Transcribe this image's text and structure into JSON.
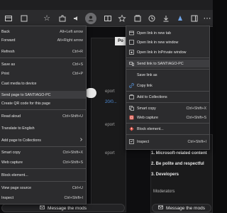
{
  "colors": {
    "menu_bg": "#2c2c2e",
    "menu_highlight": "#3d3d40",
    "page_bg": "#0e0e10",
    "web_capture_icon": "#e2564b",
    "block_element_icon": "#e2564b",
    "link_icon": "#5a9be8"
  },
  "left_menu": {
    "items": [
      {
        "label": "Back",
        "shortcut": "Alt+Left arrow"
      },
      {
        "label": "Forward",
        "shortcut": "Alt+Right arrow"
      },
      {
        "label": "Refresh",
        "shortcut": "Ctrl+R"
      },
      {
        "label": "Save as",
        "shortcut": "Ctrl+S"
      },
      {
        "label": "Print",
        "shortcut": "Ctrl+P"
      },
      {
        "label": "Cast media to device",
        "shortcut": ""
      },
      {
        "label": "Send page to SANTIAGO-PC",
        "shortcut": ""
      },
      {
        "label": "Create QR code for this page",
        "shortcut": ""
      },
      {
        "label": "Read aloud",
        "shortcut": "Ctrl+Shift+U"
      },
      {
        "label": "Translate to English",
        "shortcut": ""
      },
      {
        "label": "Add page to Collections",
        "shortcut": ""
      },
      {
        "label": "Smart copy",
        "shortcut": "Ctrl+Shift+X"
      },
      {
        "label": "Web capture",
        "shortcut": "Ctrl+Shift+S"
      },
      {
        "label": "Block element...",
        "shortcut": ""
      },
      {
        "label": "View page source",
        "shortcut": "Ctrl+U"
      },
      {
        "label": "Inspect",
        "shortcut": "Ctrl+Shift+I"
      }
    ]
  },
  "right_menu": {
    "items": [
      {
        "label": "Open link in new tab",
        "shortcut": "",
        "icon": "new-tab-icon"
      },
      {
        "label": "Open link in new window",
        "shortcut": "",
        "icon": "new-window-icon"
      },
      {
        "label": "Open link in InPrivate window",
        "shortcut": "",
        "icon": "inprivate-icon"
      },
      {
        "label": "Send link to SANTIAGO-PC",
        "shortcut": "",
        "icon": "send-icon"
      },
      {
        "label": "Save link as",
        "shortcut": "",
        "icon": ""
      },
      {
        "label": "Copy link",
        "shortcut": "",
        "icon": "link-icon"
      },
      {
        "label": "Add to Collections",
        "shortcut": "",
        "icon": "collections-icon"
      },
      {
        "label": "Smart copy",
        "shortcut": "Ctrl+Shift+X",
        "icon": "smart-copy-icon"
      },
      {
        "label": "Web capture",
        "shortcut": "Ctrl+Shift+S",
        "icon": "web-capture-icon"
      },
      {
        "label": "Block element...",
        "shortcut": "",
        "icon": "block-element-icon"
      },
      {
        "label": "Inspect",
        "shortcut": "Ctrl+Shift+I",
        "icon": "inspect-icon"
      }
    ]
  },
  "page": {
    "partial_tab": "Po",
    "report_1": "eport",
    "date_fragment": "20/0...",
    "report_2": "eport",
    "report_3": "eport",
    "rules": [
      "1. Microsoft-related content",
      "2. Be polite and respectful",
      "3. Developers"
    ],
    "moderators_heading": "Moderators",
    "message_mods_label": "Message the mods"
  }
}
